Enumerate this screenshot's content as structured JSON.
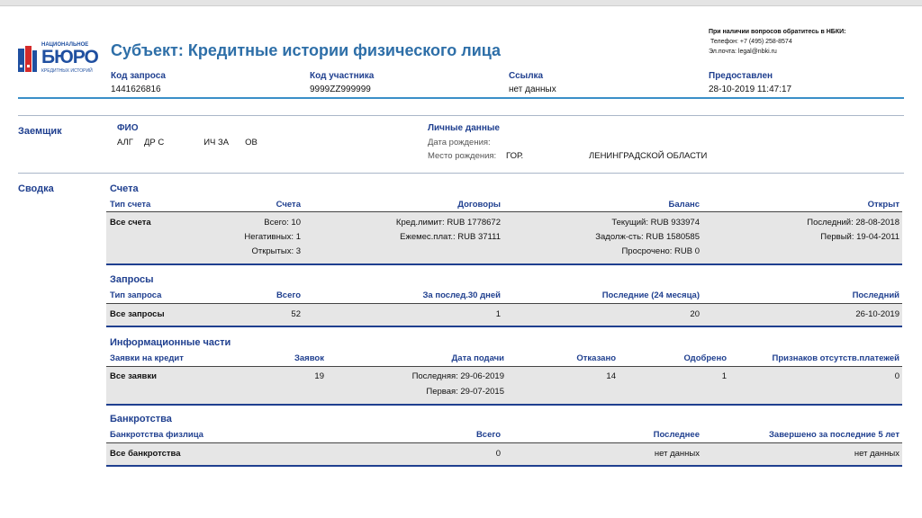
{
  "header": {
    "title": "Субъект: Кредитные истории физического лица",
    "logo": {
      "top_text": "НАЦИОНАЛЬНОЕ",
      "main_text": "БЮРО",
      "bottom_text": "КРЕДИТНЫХ ИСТОРИЙ"
    },
    "contact": {
      "title": "При наличии вопросов обратитесь в НБКИ:",
      "phone": "Телефон: +7 (495) 258-8574",
      "email": "Эл.почта: legal@nbki.ru"
    },
    "fields": [
      {
        "label": "Код запроса",
        "value": "1441626816"
      },
      {
        "label": "Код участника",
        "value": "9999ZZ999999"
      },
      {
        "label": "Ссылка",
        "value": "нет данных"
      },
      {
        "label": "Предоставлен",
        "value": "28-10-2019 11:47:17"
      }
    ]
  },
  "borrower": {
    "section_label": "Заемщик",
    "fio_label": "ФИО",
    "fio_parts": [
      "АЛГ",
      "ДР С",
      "ИЧ ЗА",
      "ОВ"
    ],
    "personal_label": "Личные данные",
    "birth_date_label": "Дата рождения:",
    "birth_place_label": "Место рождения:",
    "birth_place_start": "ГОР.",
    "birth_place_end": "ЛЕНИНГРАДСКОЙ ОБЛАСТИ"
  },
  "summary": {
    "section_label": "Сводка",
    "accounts": {
      "title": "Счета",
      "headers": [
        "Тип счета",
        "Счета",
        "Договоры",
        "Баланс",
        "Открыт"
      ],
      "row_label": "Все счета",
      "col_accounts": [
        "Всего: 10",
        "Негативных: 1",
        "Открытых: 3"
      ],
      "col_contracts": [
        "Кред.лимит: RUB 1778672",
        "Ежемес.плат.: RUB 37111"
      ],
      "col_balance": [
        "Текущий: RUB 933974",
        "Задолж-сть: RUB 1580585",
        "Просрочено: RUB 0"
      ],
      "col_opened": [
        "Последний: 28-08-2018",
        "Первый: 19-04-2011"
      ]
    },
    "inquiries": {
      "title": "Запросы",
      "headers": [
        "Тип запроса",
        "Всего",
        "За послед.30 дней",
        "Последние (24 месяца)",
        "Последний"
      ],
      "row": [
        "Все запросы",
        "52",
        "1",
        "20",
        "26-10-2019"
      ]
    },
    "info_parts": {
      "title": "Информационные части",
      "headers": [
        "Заявки на кредит",
        "Заявок",
        "Дата подачи",
        "Отказано",
        "Одобрено",
        "Признаков отсутств.платежей"
      ],
      "row_label": "Все заявки",
      "count": "19",
      "dates": [
        "Последняя: 29-06-2019",
        "Первая: 29-07-2015"
      ],
      "rejected": "14",
      "approved": "1",
      "no_payment_signs": "0"
    },
    "bankruptcies": {
      "title": "Банкротства",
      "headers": [
        "Банкротства физлица",
        "Всего",
        "Последнее",
        "Завершено за последние 5 лет"
      ],
      "row": [
        "Все банкротства",
        "0",
        "нет данных",
        "нет данных"
      ]
    }
  },
  "colors": {
    "title": "#2e6fa8",
    "label": "#1f3f8f",
    "rule": "#3a8fc8",
    "band": "#e6e6e6"
  }
}
